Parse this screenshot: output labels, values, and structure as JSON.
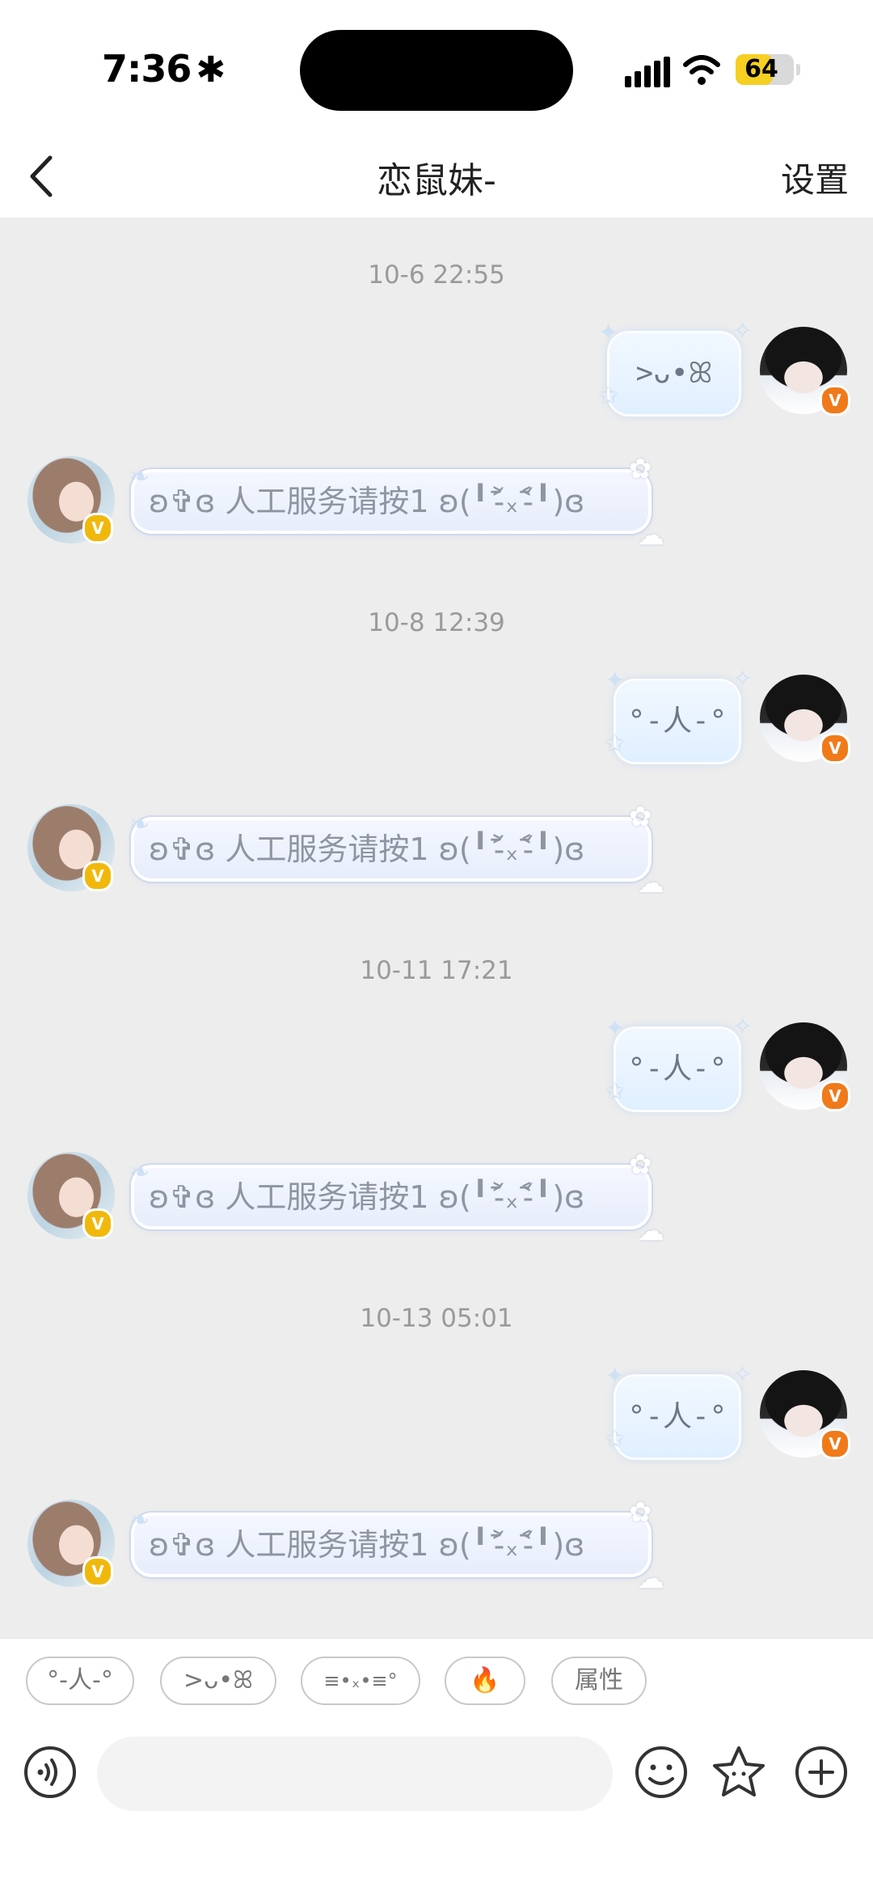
{
  "status_bar": {
    "time": "7:36",
    "time_symbol": "✱",
    "battery": "64",
    "battery_level": 0.64
  },
  "nav": {
    "title": "恋鼠妹-",
    "settings_label": "设置"
  },
  "chat": {
    "sent_avatar_badge": "V",
    "received_avatar_badge": "V",
    "received_text": "ʚ✞ɞ 人工服务请按1 ʚ(╹˃̵᷄ₓ˂̵᷄╹)ɞ",
    "blocks": [
      {
        "timestamp": "10-6 22:55",
        "sent": ">ᴗ•ꕤ"
      },
      {
        "timestamp": "10-8 12:39",
        "sent": "°-人-°"
      },
      {
        "timestamp": "10-11 17:21",
        "sent": "°-人-°"
      },
      {
        "timestamp": "10-13 05:01",
        "sent": "°-人-°"
      }
    ]
  },
  "quick_replies": [
    "°-人-°",
    ">ᴗ•ꕤ",
    "≡•ₓ•≡°",
    "🔥",
    "属性"
  ]
}
